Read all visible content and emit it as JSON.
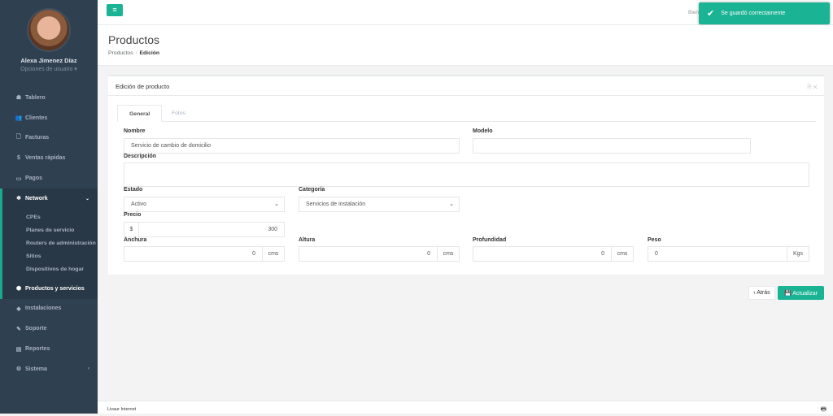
{
  "user": {
    "name": "Alexa Jimenez Díaz",
    "options": "Opciones de usuario ▾"
  },
  "nav": [
    {
      "icon": "☗",
      "label": "Tablero"
    },
    {
      "icon": "👥",
      "label": "Clientes"
    },
    {
      "icon": "🗋",
      "label": "Facturas"
    },
    {
      "icon": "$",
      "label": "Ventas rápidas"
    },
    {
      "icon": "▭",
      "label": "Pagos"
    }
  ],
  "network": {
    "icon": "❄",
    "label": "Network",
    "chevron": "⌄",
    "sub": [
      "CPEs",
      "Planes de servicio",
      "Routers de administración",
      "Sitios",
      "Dispositivos de hogar"
    ]
  },
  "nav2": [
    {
      "icon": "⬢",
      "label": "Productos y servicios"
    },
    {
      "icon": "◆",
      "label": "Instalaciones"
    },
    {
      "icon": "✎",
      "label": "Soporte"
    },
    {
      "icon": "▤",
      "label": "Reportes"
    },
    {
      "icon": "⚙",
      "label": "Sistema",
      "chevron": "‹"
    }
  ],
  "topbar": {
    "menu_icon": "≡",
    "welcome": "Bienv",
    "toast": "Se guardó correctamente"
  },
  "page": {
    "title": "Productos",
    "breadcrumb": [
      "Productos",
      "/",
      "Edición"
    ]
  },
  "panel": {
    "title": "Edición de producto",
    "tools": "🗎 ✕"
  },
  "tabs": [
    "General",
    "Fotos"
  ],
  "form": {
    "nombre_label": "Nombre",
    "nombre": "Servicio de cambio de domicilio",
    "modelo_label": "Modelo",
    "modelo": "",
    "descripcion_label": "Descripción",
    "descripcion": "",
    "estado_label": "Estado",
    "estado": "Activo",
    "categoria_label": "Categoría",
    "categoria": "Servicios de instalación",
    "precio_label": "Precio",
    "precio_prefix": "$",
    "precio": "300",
    "anchura_label": "Anchura",
    "anchura": "0",
    "anchura_unit": "cms",
    "altura_label": "Altura",
    "altura": "0",
    "altura_unit": "cms",
    "prof_label": "Profundidad",
    "prof": "0",
    "prof_unit": "cms",
    "peso_label": "Peso",
    "peso": "0",
    "peso_unit": "Kgs"
  },
  "buttons": {
    "back": "‹ Atrás",
    "update": "💾 Actualizar"
  },
  "footer": {
    "text": "Livaur Internet",
    "icon": "🖶"
  },
  "colors": {
    "accent": "#1ab394",
    "sidebar": "#2f4050"
  }
}
